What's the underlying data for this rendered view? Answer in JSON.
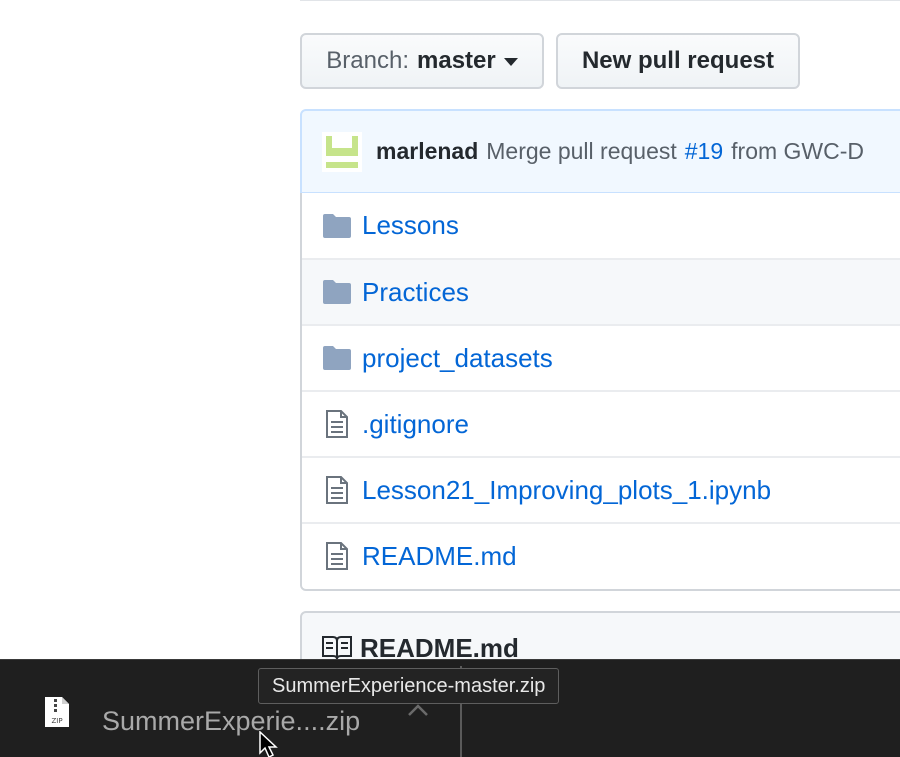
{
  "branch": {
    "label": "Branch:",
    "value": "master"
  },
  "new_pull_request": "New pull request",
  "commit": {
    "author": "marlenad",
    "message": "Merge pull request",
    "pr_number": "#19",
    "suffix": "from GWC-D"
  },
  "files": [
    {
      "name": "Lessons",
      "type": "folder"
    },
    {
      "name": "Practices",
      "type": "folder"
    },
    {
      "name": "project_datasets",
      "type": "folder"
    },
    {
      "name": ".gitignore",
      "type": "file"
    },
    {
      "name": "Lesson21_Improving_plots_1.ipynb",
      "type": "file"
    },
    {
      "name": "README.md",
      "type": "file"
    }
  ],
  "readme": {
    "title": "README.md",
    "icon": "book-icon"
  },
  "download": {
    "file_name": "SummerExperie....zip",
    "tooltip": "SummerExperience-master.zip",
    "icon_label": "ZIP"
  },
  "colors": {
    "link": "#0366d6",
    "folder": "#79b8ff",
    "commit_bg": "#f1f8ff",
    "download_bar": "#1f1f1f"
  }
}
